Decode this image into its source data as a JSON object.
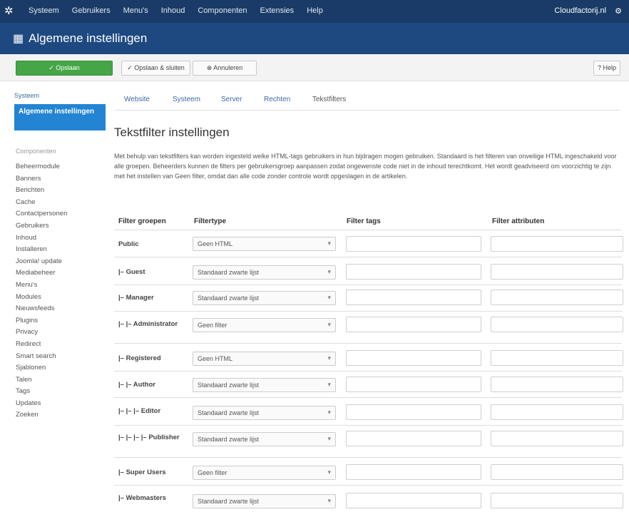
{
  "topbar": {
    "menu": [
      "Systeem",
      "Gebruikers",
      "Menu's",
      "Inhoud",
      "Componenten",
      "Extensies",
      "Help"
    ],
    "user": "Cloudfactorij.nl",
    "gear": "⚙"
  },
  "title": "Algemene instellingen",
  "toolbar": {
    "save": "Opslaan",
    "save_close": "Opslaan & sluiten",
    "cancel": "Annuleren",
    "help": "Help"
  },
  "sidebar": {
    "top_link": "Systeem",
    "active": "Algemene instellingen",
    "heading": "Componenten",
    "items": [
      "Beheermodule",
      "Banners",
      "Berichten",
      "Cache",
      "Contactpersonen",
      "Gebruikers",
      "Inhoud",
      "Installeren",
      "Joomla! update",
      "Mediabeheer",
      "Menu's",
      "Modules",
      "Nieuwsfeeds",
      "Plugins",
      "Privacy",
      "Redirect",
      "Smart search",
      "Sjablonen",
      "Talen",
      "Tags",
      "Updates",
      "Zoeken"
    ]
  },
  "tabs": [
    "Website",
    "Systeem",
    "Server",
    "Rechten",
    "Tekstfilters"
  ],
  "heading": "Tekstfilter instellingen",
  "description": "Met behulp van tekstfilters kan worden ingesteld welke HTML-tags gebruikers in hun bijdragen mogen gebruiken. Standaard is het filteren van onveilige HTML ingeschakeld voor alle groepen. Beheerders kunnen de filters per gebruikersgroep aanpassen zodat ongewenste code niet in de inhoud terechtkomt. Het wordt geadviseerd om voorzichtig te zijn met het instellen van Geen filter, omdat dan alle code zonder controle wordt opgeslagen in de artikelen.",
  "columns": {
    "group": "Filter groepen",
    "type": "Filtertype",
    "tags": "Filter tags",
    "attributes": "Filter attributen"
  },
  "rows": [
    {
      "group": "Public",
      "filter": "Geen HTML"
    },
    {
      "group": "|– Guest",
      "filter": "Standaard zwarte lijst"
    },
    {
      "group": "|– Manager",
      "filter": "Standaard zwarte lijst"
    },
    {
      "group": "|– |– Administrator",
      "filter": "Geen filter"
    },
    {
      "group": "|– Registered",
      "filter": "Geen HTML"
    },
    {
      "group": "|– |– Author",
      "filter": "Standaard zwarte lijst"
    },
    {
      "group": "|– |– |– Editor",
      "filter": "Standaard zwarte lijst"
    },
    {
      "group": "|– |– |– |– Publisher",
      "filter": "Standaard zwarte lijst"
    },
    {
      "group": "|– Super Users",
      "filter": "Geen filter"
    },
    {
      "group": "|– Webmasters",
      "filter": "Standaard zwarte lijst"
    }
  ]
}
